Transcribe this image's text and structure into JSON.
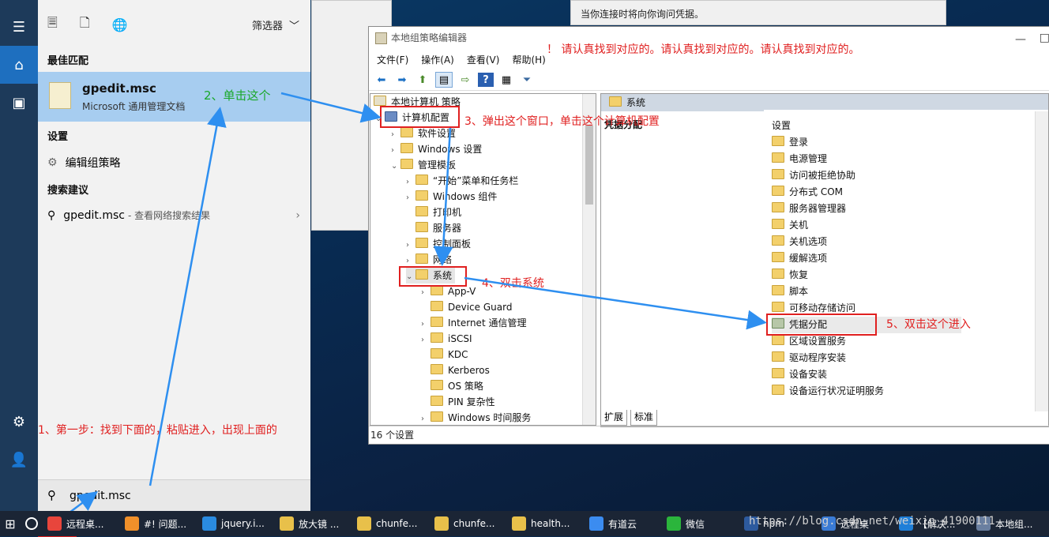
{
  "start_menu": {
    "top_icons": [
      "document-icon",
      "page-icon",
      "globe-icon"
    ],
    "filter_label": "筛选器",
    "best_match_title": "最佳匹配",
    "best_match_name": "gpedit.msc",
    "best_match_sub": "Microsoft 通用管理文档",
    "settings_title": "设置",
    "settings_item": "编辑组策略",
    "suggest_title": "搜索建议",
    "suggest_query": "gpedit.msc",
    "suggest_hint": "- 查看网络搜索结果",
    "search_value": "gpedit.msc"
  },
  "background_window": {
    "text": "当你连接时将向你询问凭据。"
  },
  "gp_window": {
    "title": "本地组策略编辑器",
    "menus": [
      "文件(F)",
      "操作(A)",
      "查看(V)",
      "帮助(H)"
    ],
    "tree": [
      {
        "label": "本地计算机 策略",
        "level": 0
      },
      {
        "label": "计算机配置",
        "level": 1
      },
      {
        "label": "软件设置",
        "level": 2
      },
      {
        "label": "Windows 设置",
        "level": 2
      },
      {
        "label": "管理模板",
        "level": 2
      },
      {
        "label": "“开始”菜单和任务栏",
        "level": 3
      },
      {
        "label": "Windows 组件",
        "level": 3
      },
      {
        "label": "打印机",
        "level": 3
      },
      {
        "label": "服务器",
        "level": 3
      },
      {
        "label": "控制面板",
        "level": 3
      },
      {
        "label": "网络",
        "level": 3
      },
      {
        "label": "系统",
        "level": 3
      },
      {
        "label": "App-V",
        "level": 4
      },
      {
        "label": "Device Guard",
        "level": 4
      },
      {
        "label": "Internet 通信管理",
        "level": 4
      },
      {
        "label": "iSCSI",
        "level": 4
      },
      {
        "label": "KDC",
        "level": 4
      },
      {
        "label": "Kerberos",
        "level": 4
      },
      {
        "label": "OS 策略",
        "level": 4
      },
      {
        "label": "PIN 复杂性",
        "level": 4
      },
      {
        "label": "Windows 时间服务",
        "level": 4
      }
    ],
    "right_header": "系统",
    "left_pane_title": "凭据分配",
    "list_header": "设置",
    "list_items": [
      "登录",
      "电源管理",
      "访问被拒绝协助",
      "分布式 COM",
      "服务器管理器",
      "关机",
      "关机选项",
      "缓解选项",
      "恢复",
      "脚本",
      "可移动存储访问",
      "凭据分配",
      "区域设置服务",
      "驱动程序安装",
      "设备安装",
      "设备运行状况证明服务"
    ],
    "tabs": [
      "扩展",
      "标准"
    ],
    "status": "16 个设置"
  },
  "annotations": {
    "warning": "！ 请认真找到对应的。请认真找到对应的。请认真找到对应的。",
    "step1": "1、第一步：找到下面的，粘贴进入，出现上面的",
    "step2": "2、单击这个",
    "step3": "3、弹出这个窗口，单击这个计算机配置",
    "step4": "4、双击系统",
    "step5": "5、双击这个进入"
  },
  "taskbar": {
    "items": [
      {
        "label": "远程桌...",
        "icon": "chrome-icon",
        "color": "#e8453c"
      },
      {
        "label": "#! 问题...",
        "icon": "sublime-icon",
        "color": "#f0902a"
      },
      {
        "label": "jquery.i...",
        "icon": "vscode-icon",
        "color": "#2a8be0"
      },
      {
        "label": "放大镜 ...",
        "icon": "folder-icon",
        "color": "#e8c04a"
      },
      {
        "label": "chunfe...",
        "icon": "folder-icon",
        "color": "#e8c04a"
      },
      {
        "label": "chunfe...",
        "icon": "folder-icon",
        "color": "#e8c04a"
      },
      {
        "label": "health...",
        "icon": "folder-icon",
        "color": "#e8c04a"
      },
      {
        "label": "有道云",
        "icon": "youdao-icon",
        "color": "#3b8cf0"
      },
      {
        "label": "微信",
        "icon": "wechat-icon",
        "color": "#2bb53c"
      },
      {
        "label": "npm",
        "icon": "powershell-icon",
        "color": "#2d5a9e"
      },
      {
        "label": "远程桌",
        "icon": "remote-icon",
        "color": "#3a7bd5"
      },
      {
        "label": "【解决...",
        "icon": "edge-icon",
        "color": "#1f7fd8"
      },
      {
        "label": "本地组...",
        "icon": "gpedit-icon",
        "color": "#6a7fa0"
      }
    ],
    "watermark": "https://blog.csdn.net/weixin_41900111"
  }
}
